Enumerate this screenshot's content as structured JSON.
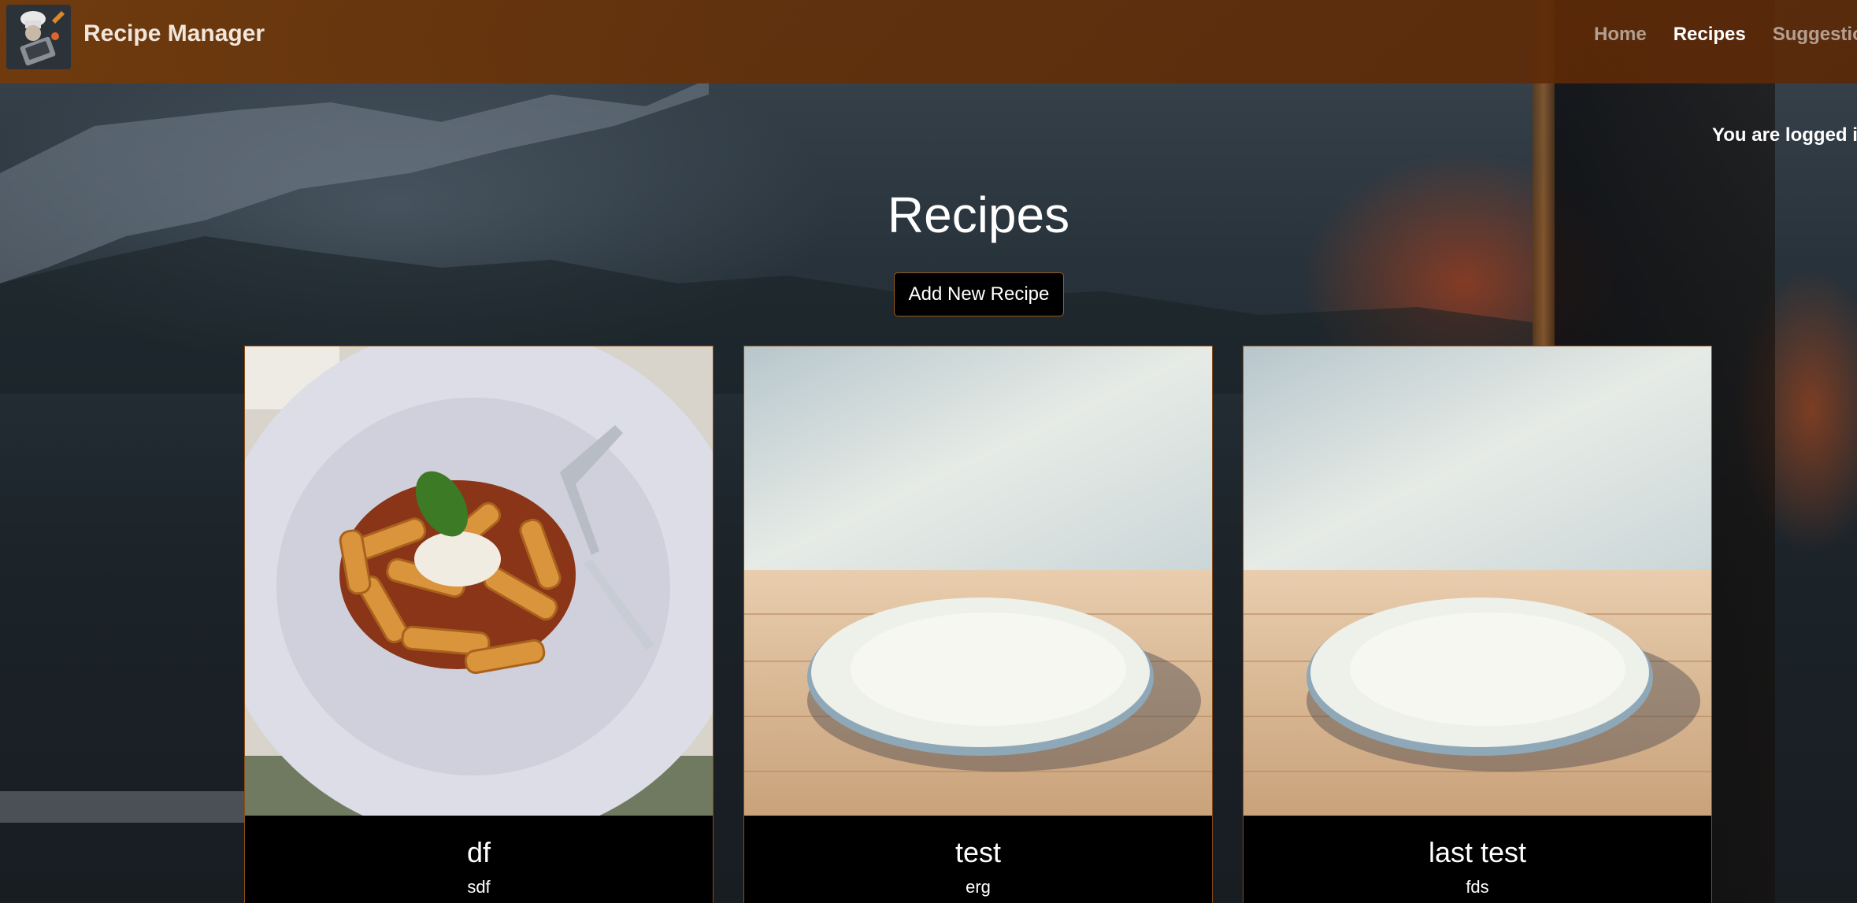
{
  "header": {
    "brand": "Recipe Manager",
    "nav": [
      "Home",
      "Recipes",
      "Suggestion"
    ],
    "active_nav": "Recipes",
    "background_color": "#6e3508"
  },
  "status": {
    "logged_in_text": "You are logged i"
  },
  "main": {
    "title": "Recipes",
    "add_button_label": "Add New Recipe"
  },
  "recipes": [
    {
      "title": "df",
      "description": "sdf",
      "image": "pasta-dish-photo"
    },
    {
      "title": "test",
      "description": "erg",
      "image": "empty-plate-photo"
    },
    {
      "title": "last test",
      "description": "fds",
      "image": "empty-plate-photo"
    }
  ],
  "colors": {
    "accent": "#9a5a1c",
    "card_background": "#000000",
    "text": "#ffffff"
  }
}
